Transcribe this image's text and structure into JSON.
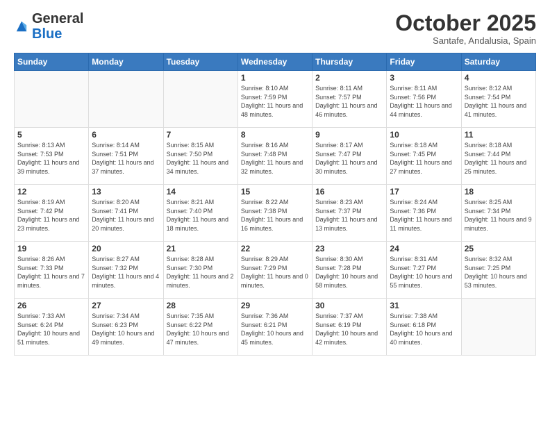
{
  "header": {
    "logo_general": "General",
    "logo_blue": "Blue",
    "month_title": "October 2025",
    "subtitle": "Santafe, Andalusia, Spain"
  },
  "weekdays": [
    "Sunday",
    "Monday",
    "Tuesday",
    "Wednesday",
    "Thursday",
    "Friday",
    "Saturday"
  ],
  "weeks": [
    [
      {
        "day": "",
        "sunrise": "",
        "sunset": "",
        "daylight": ""
      },
      {
        "day": "",
        "sunrise": "",
        "sunset": "",
        "daylight": ""
      },
      {
        "day": "",
        "sunrise": "",
        "sunset": "",
        "daylight": ""
      },
      {
        "day": "1",
        "sunrise": "Sunrise: 8:10 AM",
        "sunset": "Sunset: 7:59 PM",
        "daylight": "Daylight: 11 hours and 48 minutes."
      },
      {
        "day": "2",
        "sunrise": "Sunrise: 8:11 AM",
        "sunset": "Sunset: 7:57 PM",
        "daylight": "Daylight: 11 hours and 46 minutes."
      },
      {
        "day": "3",
        "sunrise": "Sunrise: 8:11 AM",
        "sunset": "Sunset: 7:56 PM",
        "daylight": "Daylight: 11 hours and 44 minutes."
      },
      {
        "day": "4",
        "sunrise": "Sunrise: 8:12 AM",
        "sunset": "Sunset: 7:54 PM",
        "daylight": "Daylight: 11 hours and 41 minutes."
      }
    ],
    [
      {
        "day": "5",
        "sunrise": "Sunrise: 8:13 AM",
        "sunset": "Sunset: 7:53 PM",
        "daylight": "Daylight: 11 hours and 39 minutes."
      },
      {
        "day": "6",
        "sunrise": "Sunrise: 8:14 AM",
        "sunset": "Sunset: 7:51 PM",
        "daylight": "Daylight: 11 hours and 37 minutes."
      },
      {
        "day": "7",
        "sunrise": "Sunrise: 8:15 AM",
        "sunset": "Sunset: 7:50 PM",
        "daylight": "Daylight: 11 hours and 34 minutes."
      },
      {
        "day": "8",
        "sunrise": "Sunrise: 8:16 AM",
        "sunset": "Sunset: 7:48 PM",
        "daylight": "Daylight: 11 hours and 32 minutes."
      },
      {
        "day": "9",
        "sunrise": "Sunrise: 8:17 AM",
        "sunset": "Sunset: 7:47 PM",
        "daylight": "Daylight: 11 hours and 30 minutes."
      },
      {
        "day": "10",
        "sunrise": "Sunrise: 8:18 AM",
        "sunset": "Sunset: 7:45 PM",
        "daylight": "Daylight: 11 hours and 27 minutes."
      },
      {
        "day": "11",
        "sunrise": "Sunrise: 8:18 AM",
        "sunset": "Sunset: 7:44 PM",
        "daylight": "Daylight: 11 hours and 25 minutes."
      }
    ],
    [
      {
        "day": "12",
        "sunrise": "Sunrise: 8:19 AM",
        "sunset": "Sunset: 7:42 PM",
        "daylight": "Daylight: 11 hours and 23 minutes."
      },
      {
        "day": "13",
        "sunrise": "Sunrise: 8:20 AM",
        "sunset": "Sunset: 7:41 PM",
        "daylight": "Daylight: 11 hours and 20 minutes."
      },
      {
        "day": "14",
        "sunrise": "Sunrise: 8:21 AM",
        "sunset": "Sunset: 7:40 PM",
        "daylight": "Daylight: 11 hours and 18 minutes."
      },
      {
        "day": "15",
        "sunrise": "Sunrise: 8:22 AM",
        "sunset": "Sunset: 7:38 PM",
        "daylight": "Daylight: 11 hours and 16 minutes."
      },
      {
        "day": "16",
        "sunrise": "Sunrise: 8:23 AM",
        "sunset": "Sunset: 7:37 PM",
        "daylight": "Daylight: 11 hours and 13 minutes."
      },
      {
        "day": "17",
        "sunrise": "Sunrise: 8:24 AM",
        "sunset": "Sunset: 7:36 PM",
        "daylight": "Daylight: 11 hours and 11 minutes."
      },
      {
        "day": "18",
        "sunrise": "Sunrise: 8:25 AM",
        "sunset": "Sunset: 7:34 PM",
        "daylight": "Daylight: 11 hours and 9 minutes."
      }
    ],
    [
      {
        "day": "19",
        "sunrise": "Sunrise: 8:26 AM",
        "sunset": "Sunset: 7:33 PM",
        "daylight": "Daylight: 11 hours and 7 minutes."
      },
      {
        "day": "20",
        "sunrise": "Sunrise: 8:27 AM",
        "sunset": "Sunset: 7:32 PM",
        "daylight": "Daylight: 11 hours and 4 minutes."
      },
      {
        "day": "21",
        "sunrise": "Sunrise: 8:28 AM",
        "sunset": "Sunset: 7:30 PM",
        "daylight": "Daylight: 11 hours and 2 minutes."
      },
      {
        "day": "22",
        "sunrise": "Sunrise: 8:29 AM",
        "sunset": "Sunset: 7:29 PM",
        "daylight": "Daylight: 11 hours and 0 minutes."
      },
      {
        "day": "23",
        "sunrise": "Sunrise: 8:30 AM",
        "sunset": "Sunset: 7:28 PM",
        "daylight": "Daylight: 10 hours and 58 minutes."
      },
      {
        "day": "24",
        "sunrise": "Sunrise: 8:31 AM",
        "sunset": "Sunset: 7:27 PM",
        "daylight": "Daylight: 10 hours and 55 minutes."
      },
      {
        "day": "25",
        "sunrise": "Sunrise: 8:32 AM",
        "sunset": "Sunset: 7:25 PM",
        "daylight": "Daylight: 10 hours and 53 minutes."
      }
    ],
    [
      {
        "day": "26",
        "sunrise": "Sunrise: 7:33 AM",
        "sunset": "Sunset: 6:24 PM",
        "daylight": "Daylight: 10 hours and 51 minutes."
      },
      {
        "day": "27",
        "sunrise": "Sunrise: 7:34 AM",
        "sunset": "Sunset: 6:23 PM",
        "daylight": "Daylight: 10 hours and 49 minutes."
      },
      {
        "day": "28",
        "sunrise": "Sunrise: 7:35 AM",
        "sunset": "Sunset: 6:22 PM",
        "daylight": "Daylight: 10 hours and 47 minutes."
      },
      {
        "day": "29",
        "sunrise": "Sunrise: 7:36 AM",
        "sunset": "Sunset: 6:21 PM",
        "daylight": "Daylight: 10 hours and 45 minutes."
      },
      {
        "day": "30",
        "sunrise": "Sunrise: 7:37 AM",
        "sunset": "Sunset: 6:19 PM",
        "daylight": "Daylight: 10 hours and 42 minutes."
      },
      {
        "day": "31",
        "sunrise": "Sunrise: 7:38 AM",
        "sunset": "Sunset: 6:18 PM",
        "daylight": "Daylight: 10 hours and 40 minutes."
      },
      {
        "day": "",
        "sunrise": "",
        "sunset": "",
        "daylight": ""
      }
    ]
  ]
}
